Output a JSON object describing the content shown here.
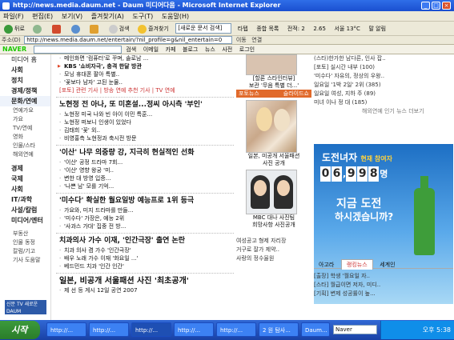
{
  "window": {
    "title": "http://news.media.daum.net - Daum 미디어다음 - Microsoft Internet Explorer"
  },
  "menu": [
    "파일(F)",
    "편집(E)",
    "보기(V)",
    "즐겨찾기(A)",
    "도구(T)",
    "도움말(H)"
  ],
  "toolbar": {
    "back": "뒤로",
    "search": "검색",
    "favorites": "즐겨찾기",
    "search_box": "[새로운 문서 검색]",
    "tab": "타텝",
    "weather": "종합 목록",
    "cert": "전적: 2",
    "mail": "2.65",
    "weather2": "서울 13°C",
    "mail2": "말 알림"
  },
  "address": {
    "label": "주소(D)",
    "url": "http://news.media.daum.net/entertain/?nil_profile=g&nil_entertain=0",
    "go": "이동",
    "links": "연결"
  },
  "naver": {
    "logo": "NAVER",
    "items": [
      "검색",
      "이메일",
      "카페",
      "블로그",
      "뉴스",
      "사전"
    ],
    "login": "로그인"
  },
  "left_nav": {
    "items": [
      {
        "label": "미디어 홈",
        "bold": false
      },
      {
        "label": "사회",
        "bold": true
      },
      {
        "label": "정치",
        "bold": true
      },
      {
        "label": "경제/정책",
        "bold": true
      },
      {
        "label": "문화/연예",
        "bold": true
      }
    ],
    "sub": [
      "연예가요",
      "가요",
      "TV/연예",
      "영화",
      "인물/스타",
      "해외연예"
    ],
    "items2": [
      "경제",
      "국제",
      "사회",
      "IT/과학",
      "사설/칼럼",
      "미디어/엔터"
    ],
    "items3": [
      "부동산",
      "인물 동정",
      "칼럼/기고",
      "기사 도움말"
    ],
    "ad": "신문 TV 새로운 DAUM"
  },
  "main": {
    "top_news": [
      "메인화면 '컴퓨터'로 꾸며, 솔로남 ...",
      "KBS '쇼비자극', 충격 한달 방관",
      "모닝 휴대폰 팔아 특별..",
      "'꽃보다 남자' 고된 눈물.."
    ],
    "tags": "[포토] 관련 기사 | 방송 연예 추천 기사 | TV 연예",
    "h1": "노현정 전 아나, 또 미혼설...정씨 아시측 '부인'",
    "h1_news": [
      "노현정 미국 나와 빈 아이 이민 특훈...",
      "노현정 떠보니 인생이 있었다",
      "김태희 '꽃' 외..",
      "비영홍측 노현정과 축시전 방문"
    ],
    "h2": "'이산' 나무 의중량 강, 지극히 현실적인 선화",
    "h2_news": [
      "'이산' 공정 드라마 7회...",
      "'이산' 영향 왕궁 '미..",
      "변한 대 방영 입증...",
      "'나쁜 남' 모를 기억..."
    ],
    "h3": "'미수다' 확실한 월요일방 예능프로 1위 등극",
    "h3_news": [
      "가요와, 미지 드라마를 만들...",
      "'미수다' 가장은, 예능 2위",
      "'사과스 가대' 집중 전 방..."
    ],
    "h4": "치과의사 가수 이재, '인간극장' 출연 논란",
    "h4_news": [
      "치과 의사 겸 가수 '인간극장'",
      "배우 노래 가수 이재 '화요일 ...'",
      "베드민드 치과 '인간 인간'"
    ],
    "h5": "일본, 비공개 서울패션 사진 '최초공개'",
    "bottom": "제 선 등 게시 12일 공연 2007"
  },
  "side": {
    "photo1_caption": "[할론 스타인터뷰]",
    "photo1_sub": "보관 '무음 특별 더...'",
    "tag_label": "포토뉴스",
    "tag_right": "슬라이드쇼",
    "photo2_caption": "일본, 미공개 서울패션",
    "photo2_sub": "사진 공개",
    "photo3_caption": "MBC 대나 사진팀",
    "photo3_sub": "희망사항 사진공개",
    "bottom_list": [
      "여성공고 형제 자리장",
      "거구로 잘가 제약..",
      "사랑의 정수율원"
    ]
  },
  "right": {
    "top_list": [
      "(스타)한가한 남다른, 인사 잡..",
      "[포토] 실시간 내부 (100)",
      "'미수다' 자유의, 정상의 우왕..",
      "일요일 '1박 2일' 2위 (385)",
      "일요일 여성, 지하 주 (89)",
      "미녀 이나 정 대 (185)"
    ],
    "more": "해외연예 인기 뉴스 더보기",
    "ad_title": "도전녀자",
    "ad_title_small": "현재 참여자",
    "ad_digits": [
      "0",
      "6",
      "9",
      "9",
      "8"
    ],
    "ad_sep": ",",
    "ad_unit": "명",
    "ad_q1": "지금 도전",
    "ad_q2": "하시겠습니까?",
    "tabs": [
      "아고라",
      "랭킹뉴스",
      "세계인"
    ],
    "list": [
      "[출장] 학생 '월요일 자..",
      "[스타] 월급이면 저자, 미디..",
      "[기획] 변제 성공률이 높..."
    ]
  },
  "taskbar": {
    "start": "시작",
    "tasks": [
      "http://...",
      "http://...",
      "http://...",
      "http://...",
      "http://...",
      "2 원 탐사...",
      "Daum..."
    ],
    "search": "Naver",
    "clock": "오후 5:38"
  },
  "status": "완료"
}
